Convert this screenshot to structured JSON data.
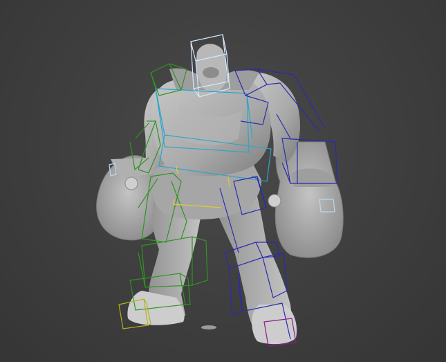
{
  "viewport": {
    "background": "#3f3f3f",
    "model_color": "#bcbcbc"
  },
  "bones": {
    "head_color": "#cfe6ff",
    "spine_color": "#2aa4c8",
    "left_side_color": "#2f8f1f",
    "right_side_color": "#2b2ba8",
    "pelvis_color": "#d8c23a",
    "left_foot_color": "#a3a31a",
    "right_foot_color": "#8a1a8a"
  }
}
